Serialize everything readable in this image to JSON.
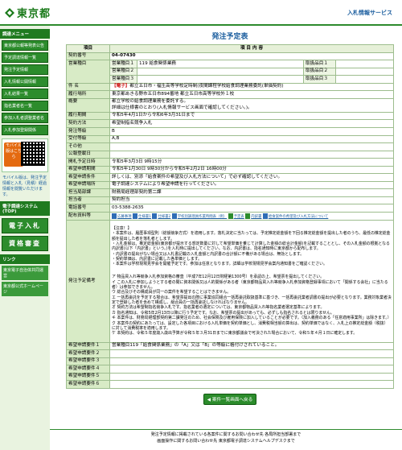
{
  "header": {
    "logo_text": "東京都",
    "site_label": "入札情報サービス"
  },
  "sidebar": {
    "menu_heading": "調達メニュー",
    "menu_items": [
      "東京都公報等発表公告",
      "予定調達情報一覧",
      "発注予定情報",
      "入札情報公開情報",
      "入札結果一覧",
      "指名業者名一覧",
      "参加入札者調整業者名",
      "入札参加登録関係"
    ],
    "mobile_label": "モバイル版はこちら",
    "mobile_note": "モバイル版は、発注予定情報と入札（見積）経過情報を閲覧いただけます。",
    "system_heading": "電子調達システム(TOP)",
    "bid_button": "電子入札",
    "qual_button": "資格審査",
    "links_heading": "リンク",
    "links": [
      "東京電子自治体共同運営",
      "東京都公式ホームページ"
    ]
  },
  "page": {
    "title": "発注予定表",
    "col_item": "項目",
    "col_content": "項 目 内 容",
    "back_button": "案件一覧画面へ戻る",
    "footer_line1": "発注予定情報に掲載されている各案件に関するお問い合わせ先 各局所担当部署まで",
    "footer_line2": "画面操作に関するお問い合わせ先 東京都電子調達システムヘルプデスクまで"
  },
  "rows": {
    "contract_no_label": "契約番号",
    "contract_no": "04-07430",
    "category_label": "営業種目",
    "category_1_label": "営業種目１",
    "category_1": "119 給食関係業務",
    "category_2_label": "営業種目２",
    "category_2": "",
    "category_3_label": "営業種目３",
    "category_3": "",
    "sub_1_label": "取扱品目１",
    "sub_1": "",
    "sub_2_label": "取扱品目２",
    "sub_2": "",
    "sub_3_label": "取扱品目３",
    "sub_3": "",
    "subject_label": "件 名",
    "subject_tag": "【電子】",
    "subject": "都立五日市・福生高等学校定時制(夜間課程学校給食調理業務委託(単価契約)",
    "location_label": "履行場所",
    "location": "東京都あきる野市五日市894番地 都立五日市高等学校外１校",
    "summary_label": "概要",
    "summary": "都立学校の給食調理業務を委託する。\n詳細は仕様書のとおり(入札情報サービス画面で確認してください。)。",
    "period_label": "履行期間",
    "period": "令和5年4月1日から令和6年3月31日まで",
    "method_label": "契約方法",
    "method": "希望制指名競争入札",
    "grade_label": "発注等級",
    "grade": "B",
    "accept_grade_label": "受付等級",
    "accept_grade": "A,B",
    "other_label": "その他",
    "other": "",
    "announce_label": "公報登載日",
    "announce": "",
    "open_label": "開札予定日時",
    "open": "令和5年3月3日 9時15分",
    "apply_label": "希望申請期間",
    "apply": "令和5年1月30日 9時30分から令和5年2月2日 16時00分",
    "cond_label": "希望申請条件",
    "cond": "詳しくは、別添「給食案件の希望及び入札方法について」で必ず確認してください。",
    "subm_label": "希望申請場所",
    "subm": "電子調達システムにより希望申請を行ってください。",
    "section_label": "担当局部課",
    "section": "財務局経理部契約第二課",
    "person_label": "担当者",
    "person": "契約担当",
    "tel_label": "電話番号",
    "tel": "03-5388-2635",
    "attach_label": "配布資料等",
    "attach_files": [
      "応募事項",
      "仕様書1",
      "仕様書2",
      "学校別調理員作業時間表（例）",
      "予定表",
      "内訳書",
      "給食案件の希望及び入札方法について"
    ],
    "notes_label": "発注予定備考",
    "notes_p1": "【注意！】\n・本案件は、履歴事項型則（総額競争方式）を適用します。落札決定に当たっては、予定推定総金額を下回る推定総金額を提出した者のうち、最低の推定総金額を提出した者を落札者とします。\n・入札金額は、推定総金額(東京都が提示する想定数量に対して希望単価を乗じて計算した金額の総合計金額)を記載することとし、その入札金額の根拠となる内訳書(以下「内訳書」という。)を入札時に提出してください。なお、内訳書は、指名通知時に東京都から配布します。\n・内訳書の提出がない場合又は入札書記載の入札金額と内訳書の合計額に不備がある場合は、無効とします。\n・契約単価は、内訳書に記載した各単価とします。\n・本案件は学校現場見学会を開催予定です。参加は任意となります。詳細は学校現場見学会案内通知書をご確認ください。",
    "notes_p2": "ア 物品買入れ等競争入札参加資格の審査（平成7年12月12日財経第1300号）を承認の上、希望票を提出してください。\nイ この入札に参加しようとする者の聞に資本関係又は人的関係がある者（東京都物品買入れ等競争入札参加資格登録事項において「関係する会社」に当たる者）は参加できません。\nウ 総合及びその構成員が同一の案件を希望することはできません。\nエ 一括再委託を予定する場合は、希望票提出の際に事業協同組合一括再委託取扱基準に基づき、一括再委託業者調書の提出が必要となります。業務対象業者決定で登録した者を含めて構成し、組合員の一括再委託しなければなりません。\nオ 契約方法は希望制指名競争入札です。指名業者の選定については、東京都物品買入れ等指名業者選定基準によります。\nカ 指名通知は、令和5年2月13日以降に行う予定です。なお、希望票の提出があっても、必ずしも指名されるとは限りません。\nキ 本案件は、財務局経理部契約第二課発注のため、社会保険及び雇用保険に加入していることが必要です。（加入義務のある「任意適用事業所」は除きます。）\nク 本案件の契約にあたっては、設定した各項目における入札単価を契約単価とし、消費税相当額の算出は、契約単価ではなく、入札上の推定総金額（税抜）に対して消費税率を適用します。\nケ 本契約は、令和５年度歳入歳出予算が令和５年３月31日までに東京都議会で可決された場合において、令和５年４月１日に確定します。",
    "cond1_label": "希望申請要件１",
    "cond1": "営業種目119「給食関係業務」の「A」又は「B」の等級に格付けされていること。",
    "cond2_label": "希望申請要件２",
    "cond3_label": "希望申請要件３",
    "cond4_label": "希望申請要件４",
    "cond5_label": "希望申請要件５",
    "cond6_label": "希望申請要件６",
    "empty": ""
  },
  "colors": {
    "brand_green": "#2c8c2c",
    "title_blue": "#1a5d9e",
    "alert_red": "#d01010"
  }
}
